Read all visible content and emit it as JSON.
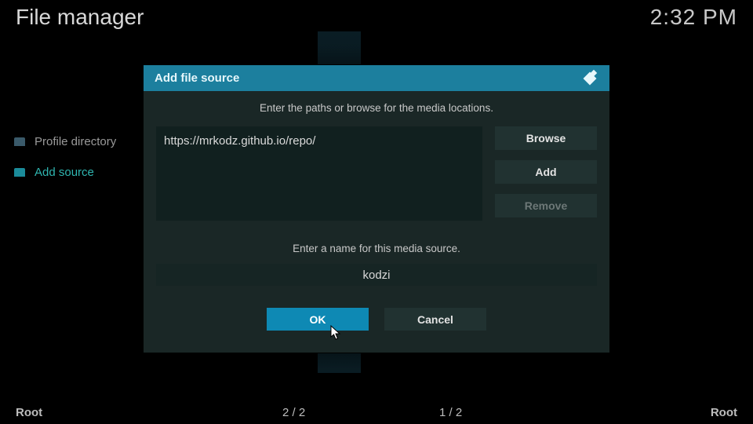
{
  "header": {
    "title": "File manager",
    "clock": "2:32 PM"
  },
  "sidebar": {
    "items": [
      {
        "label": "Profile directory",
        "active": false
      },
      {
        "label": "Add source",
        "active": true
      }
    ]
  },
  "footer": {
    "left_root": "Root",
    "count_left": "2 / 2",
    "count_right": "1 / 2",
    "right_root": "Root"
  },
  "dialog": {
    "title": "Add file source",
    "hint_paths": "Enter the paths or browse for the media locations.",
    "path_value": "https://mrkodz.github.io/repo/",
    "browse_label": "Browse",
    "add_label": "Add",
    "remove_label": "Remove",
    "hint_name": "Enter a name for this media source.",
    "name_value": "kodzi",
    "ok_label": "OK",
    "cancel_label": "Cancel"
  }
}
